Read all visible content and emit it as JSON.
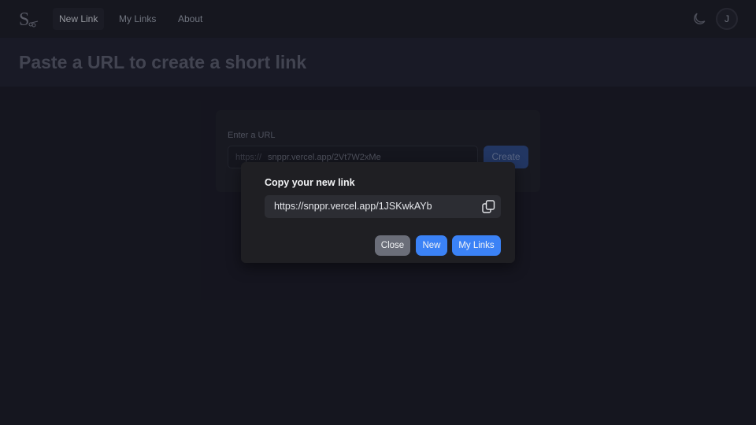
{
  "nav": {
    "logo_icon": "scissors-s-logo-icon",
    "links": [
      {
        "label": "New Link",
        "active": true
      },
      {
        "label": "My Links",
        "active": false
      },
      {
        "label": "About",
        "active": false
      }
    ],
    "theme_icon": "moon-icon",
    "avatar_initial": "J"
  },
  "header": {
    "title": "Paste a URL to create a short link"
  },
  "form": {
    "label": "Enter a URL",
    "input_prefix": "https://",
    "input_value": "snppr.vercel.app/2Vt7W2xMe",
    "create_label": "Create"
  },
  "modal": {
    "title": "Copy your new link",
    "short_link": "https://snppr.vercel.app/1JSKwkAYb",
    "copy_icon": "copy-icon",
    "buttons": {
      "close": "Close",
      "new": "New",
      "my_links": "My Links"
    }
  },
  "colors": {
    "background": "#1a1b26",
    "accent": "#3b82f6",
    "modal": "#1f1f23",
    "close_button": "#6b6e79"
  }
}
